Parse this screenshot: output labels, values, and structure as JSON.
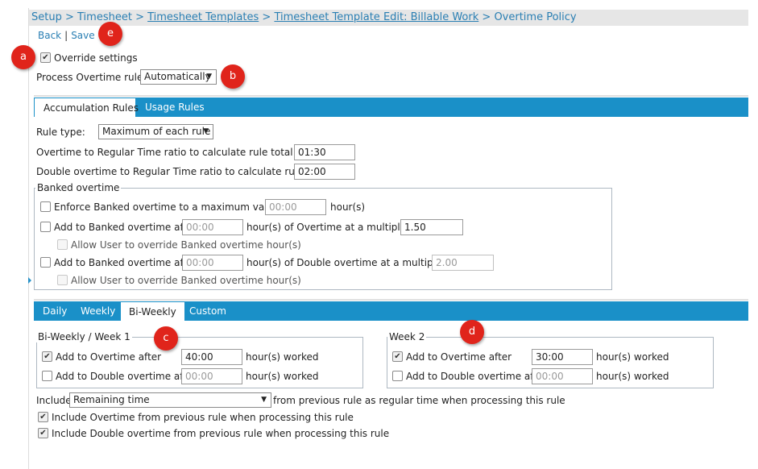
{
  "breadcrumb": {
    "setup": "Setup",
    "sep1": " > ",
    "timesheet": "Timesheet",
    "sep2": " > ",
    "templates": "Timesheet Templates",
    "sep3": " > ",
    "template_edit": "Timesheet Template Edit: Billable Work",
    "sep4": " > ",
    "current": "Overtime Policy"
  },
  "actions": {
    "back": "Back",
    "separator": "|",
    "save": "Save"
  },
  "override": {
    "label": "Override settings",
    "checked": true
  },
  "process": {
    "label": "Process Overtime rules:",
    "value": "Automatically"
  },
  "rule_tabs": {
    "accumulation": "Accumulation Rules",
    "usage": "Usage Rules"
  },
  "rule_type": {
    "label": "Rule type:",
    "value": "Maximum of each rule"
  },
  "ot_ratio": {
    "label": "Overtime to Regular Time ratio to calculate rule total:",
    "value": "01:30"
  },
  "dot_ratio": {
    "label": "Double overtime to Regular Time ratio to calculate rule total:",
    "value": "02:00"
  },
  "banked": {
    "legend": "Banked overtime",
    "enforce": {
      "label": "Enforce Banked overtime to a maximum value of",
      "placeholder": "00:00",
      "unit": "hour(s)"
    },
    "add_ot": {
      "label": "Add to Banked overtime after",
      "placeholder": "00:00",
      "mid": "hour(s) of Overtime at a multiple of",
      "value": "1.50"
    },
    "allow_ot": "Allow User to override Banked overtime hour(s)",
    "add_dot": {
      "label": "Add to Banked overtime after",
      "placeholder": "00:00",
      "mid": "hour(s) of Double overtime at a multiple of",
      "value": "2.00"
    },
    "allow_dot": "Allow User to override Banked overtime hour(s)"
  },
  "period_tabs": {
    "daily": "Daily",
    "weekly": "Weekly",
    "biweekly": "Bi-Weekly",
    "custom": "Custom"
  },
  "week1": {
    "legend": "Bi-Weekly / Week 1",
    "ot_label": "Add to Overtime after",
    "ot_value": "40:00",
    "ot_unit": "hour(s) worked",
    "dot_label": "Add to Double overtime after",
    "dot_placeholder": "00:00",
    "dot_unit": "hour(s) worked"
  },
  "week2": {
    "legend": "Week 2",
    "ot_label": "Add to Overtime after",
    "ot_value": "30:00",
    "ot_unit": "hour(s) worked",
    "dot_label": "Add to Double overtime after",
    "dot_placeholder": "00:00",
    "dot_unit": "hour(s) worked"
  },
  "include": {
    "prefix": "Include",
    "value": "Remaining time",
    "suffix": "from previous rule as regular time when processing this rule"
  },
  "include_ot": "Include Overtime from previous rule when processing this rule",
  "include_dot": "Include Double overtime from previous rule when processing this rule",
  "callouts": {
    "a": "a",
    "b": "b",
    "c": "c",
    "d": "d",
    "e": "e"
  },
  "check_glyph": "✔",
  "dropdown_glyph": "▼",
  "colors": {
    "accent": "#1a90c8",
    "link": "#2a7fb3",
    "callout": "#e0241b"
  }
}
